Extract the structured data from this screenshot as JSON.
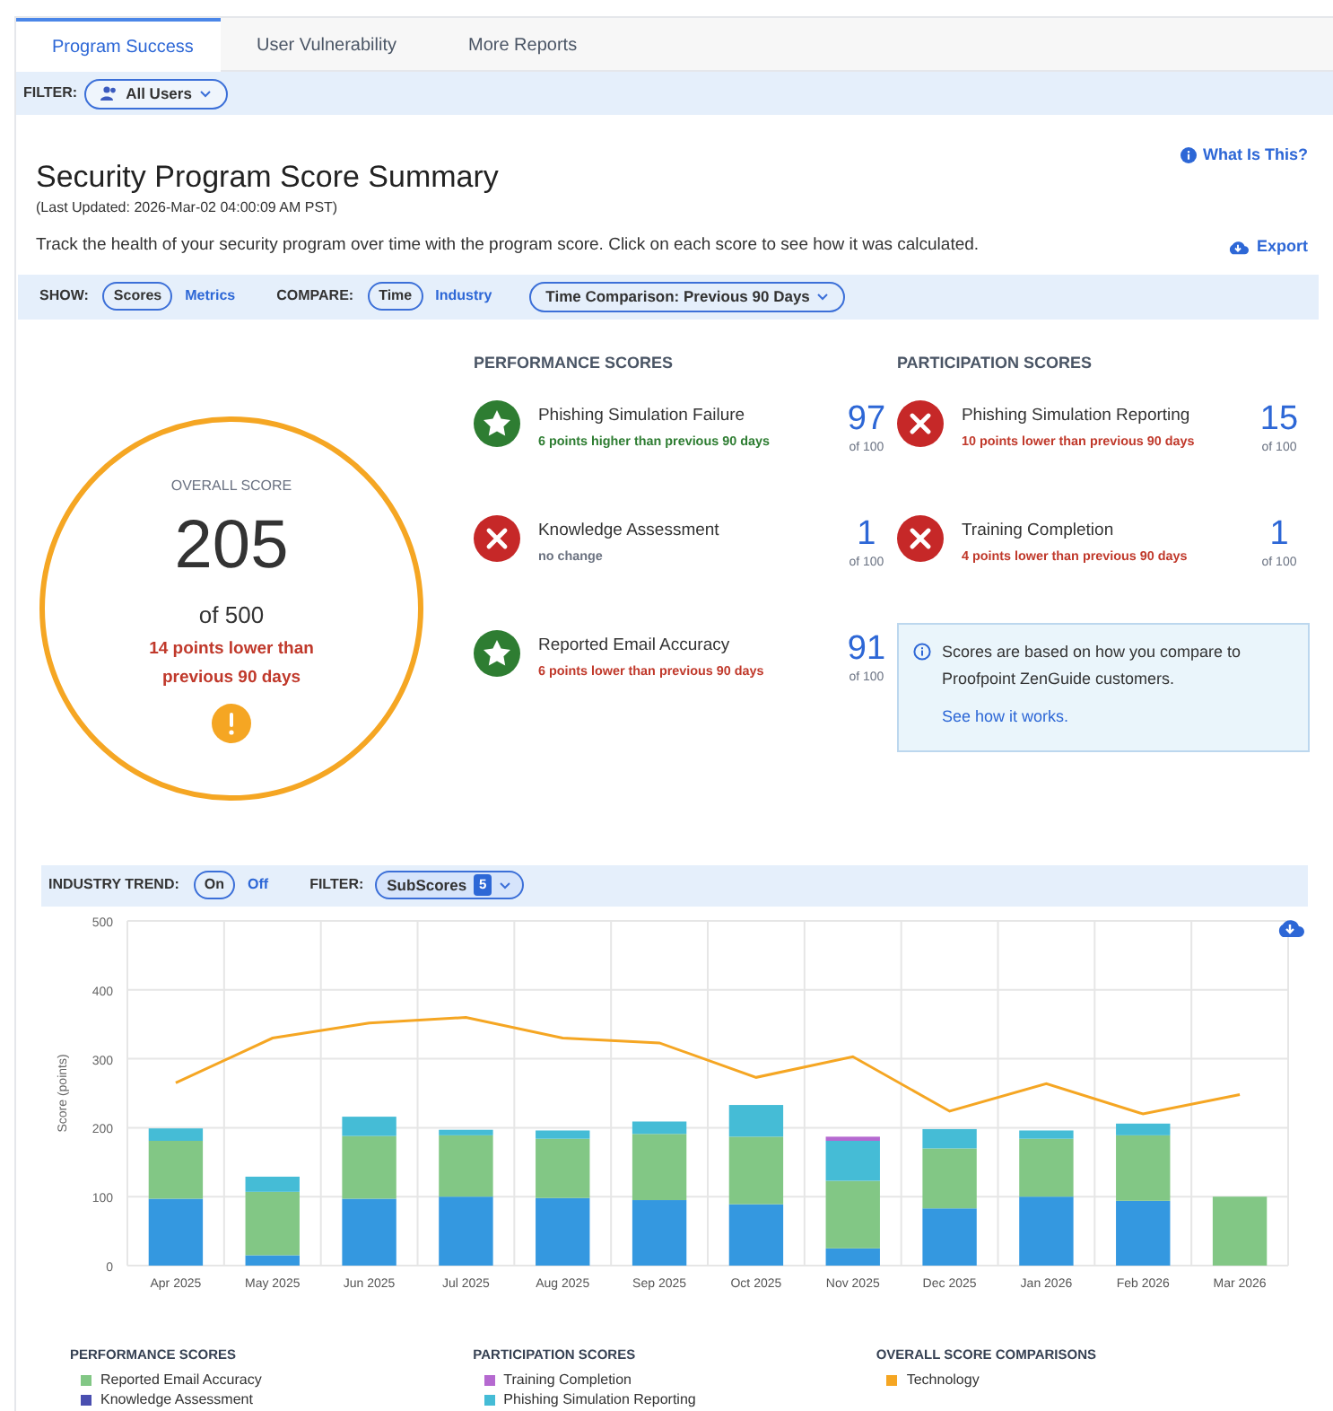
{
  "tabs": [
    {
      "label": "Program Success",
      "selected": true
    },
    {
      "label": "User Vulnerability",
      "selected": false
    },
    {
      "label": "More Reports",
      "selected": false
    }
  ],
  "filter": {
    "label": "FILTER:",
    "value": "All Users"
  },
  "header": {
    "title": "Security Program Score Summary",
    "updated": "(Last Updated: 2026-Mar-02 04:00:09 AM PST)",
    "description": "Track the health of your security program over time with the program score. Click on each score to see how it was calculated.",
    "help_link": "What Is This?",
    "export": "Export"
  },
  "controls": {
    "show_label": "SHOW:",
    "show_options": [
      {
        "label": "Scores",
        "selected": true
      },
      {
        "label": "Metrics",
        "selected": false
      }
    ],
    "compare_label": "COMPARE:",
    "compare_options": [
      {
        "label": "Time",
        "selected": true
      },
      {
        "label": "Industry",
        "selected": false
      }
    ],
    "comparison": "Time Comparison: Previous 90 Days"
  },
  "overall": {
    "label": "OVERALL SCORE",
    "score": "205",
    "of": "of 500",
    "change": "14 points lower than previous 90 days",
    "warning": true
  },
  "performance": {
    "heading": "PERFORMANCE SCORES",
    "items": [
      {
        "name": "Phishing Simulation Failure",
        "change": "6 points higher than previous 90 days",
        "color": "#2e7d32",
        "kind": "good",
        "score": "97",
        "of": "of 100"
      },
      {
        "name": "Knowledge Assessment",
        "change": "no change",
        "color": "#6b7280",
        "kind": "bad",
        "score": "1",
        "of": "of 100"
      },
      {
        "name": "Reported Email Accuracy",
        "change": "6 points lower than previous 90 days",
        "color": "#c0392b",
        "kind": "good",
        "score": "91",
        "of": "of 100"
      }
    ]
  },
  "participation": {
    "heading": "PARTICIPATION SCORES",
    "items": [
      {
        "name": "Phishing Simulation Reporting",
        "change": "10 points lower than previous 90 days",
        "color": "#c0392b",
        "kind": "bad",
        "score": "15",
        "of": "of 100"
      },
      {
        "name": "Training Completion",
        "change": "4 points lower than previous 90 days",
        "color": "#c0392b",
        "kind": "bad",
        "score": "1",
        "of": "of 100"
      }
    ],
    "note": "Scores are based on how you compare to Proofpoint ZenGuide customers.",
    "note_link": "See how it works."
  },
  "trend_bar": {
    "label": "INDUSTRY TREND:",
    "options": [
      {
        "label": "On",
        "selected": true
      },
      {
        "label": "Off",
        "selected": false
      }
    ],
    "filter_label": "FILTER:",
    "filter_value": "SubScores",
    "filter_count": "5"
  },
  "chart": {
    "chart_data": {
      "type": "bar",
      "stacked": true,
      "grid": true,
      "ylabel": "Score (points)",
      "ylim": [
        0,
        500
      ],
      "yticks": [
        0,
        100,
        200,
        300,
        400,
        500
      ],
      "categories": [
        "Apr 2025",
        "May 2025",
        "Jun 2025",
        "Jul 2025",
        "Aug 2025",
        "Sep 2025",
        "Oct 2025",
        "Nov 2025",
        "Dec 2025",
        "Jan 2026",
        "Feb 2026",
        "Mar 2026"
      ],
      "series": [
        {
          "color": "#3498e0",
          "values": [
            97,
            15,
            97,
            100,
            98,
            95,
            89,
            25,
            83,
            100,
            94,
            0
          ]
        },
        {
          "name": "Knowledge Assessment",
          "color": "#4a4fb0",
          "values": [
            null,
            null,
            null,
            null,
            null,
            null,
            null,
            null,
            null,
            null,
            null,
            null
          ]
        },
        {
          "name": "Reported Email Accuracy",
          "color": "#82c785",
          "values": [
            84,
            92,
            91,
            89,
            86,
            96,
            98,
            98,
            87,
            84,
            95,
            100
          ]
        },
        {
          "name": "Phishing Simulation Reporting",
          "color": "#45bcd6",
          "values": [
            18,
            22,
            28,
            8,
            12,
            18,
            46,
            58,
            28,
            12,
            17,
            0
          ]
        },
        {
          "name": "Training Completion",
          "color": "#b569d0",
          "values": [
            0,
            0,
            0,
            0,
            0,
            0,
            0,
            6,
            0,
            0,
            0,
            0
          ]
        },
        {
          "name": "Technology",
          "color": "#f5a623",
          "type": "line",
          "values": [
            265,
            330,
            352,
            360,
            330,
            323,
            273,
            303,
            224,
            264,
            220,
            248
          ]
        }
      ]
    },
    "legend_headings": [
      "PERFORMANCE SCORES",
      "PARTICIPATION SCORES",
      "OVERALL SCORE COMPARISONS"
    ]
  }
}
